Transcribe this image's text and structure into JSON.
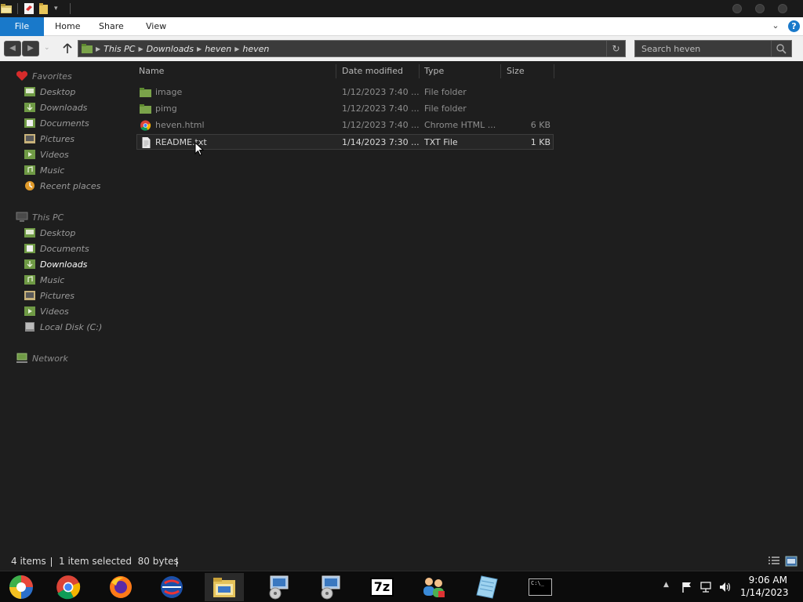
{
  "window": {
    "quick_access": [
      "explorer-icon",
      "properties-icon",
      "new-folder-icon",
      "customize-qa-icon"
    ]
  },
  "ribbon": {
    "tabs": [
      {
        "label": "File"
      },
      {
        "label": "Home"
      },
      {
        "label": "Share"
      },
      {
        "label": "View"
      }
    ],
    "help": "?"
  },
  "navbar": {
    "breadcrumb": [
      "This PC",
      "Downloads",
      "heven",
      "heven"
    ],
    "search_placeholder": "Search heven"
  },
  "sidebar": {
    "favorites": {
      "label": "Favorites",
      "items": [
        {
          "label": "Desktop",
          "icon": "desktop-icon"
        },
        {
          "label": "Downloads",
          "icon": "downloads-folder-icon"
        },
        {
          "label": "Documents",
          "icon": "documents-icon"
        },
        {
          "label": "Pictures",
          "icon": "pictures-icon"
        },
        {
          "label": "Videos",
          "icon": "videos-icon"
        },
        {
          "label": "Music",
          "icon": "music-icon"
        },
        {
          "label": "Recent places",
          "icon": "recent-places-icon"
        }
      ]
    },
    "this_pc": {
      "label": "This PC",
      "items": [
        {
          "label": "Desktop",
          "icon": "desktop-icon"
        },
        {
          "label": "Documents",
          "icon": "documents-icon"
        },
        {
          "label": "Downloads",
          "icon": "downloads-folder-icon",
          "active": true
        },
        {
          "label": "Music",
          "icon": "music-icon"
        },
        {
          "label": "Pictures",
          "icon": "pictures-icon"
        },
        {
          "label": "Videos",
          "icon": "videos-icon"
        },
        {
          "label": "Local Disk (C:)",
          "icon": "local-disk-icon"
        }
      ]
    },
    "network": {
      "label": "Network"
    }
  },
  "files": {
    "columns": [
      "Name",
      "Date modified",
      "Type",
      "Size"
    ],
    "rows": [
      {
        "name": "image",
        "date": "1/12/2023 7:40 ...",
        "type": "File folder",
        "size": "",
        "icon": "folder-icon"
      },
      {
        "name": "pimg",
        "date": "1/12/2023 7:40 ...",
        "type": "File folder",
        "size": "",
        "icon": "folder-icon"
      },
      {
        "name": "heven.html",
        "date": "1/12/2023 7:40 ...",
        "type": "Chrome HTML ...",
        "size": "6 KB",
        "icon": "chrome-html-icon"
      },
      {
        "name": "README.txt",
        "date": "1/14/2023 7:30 ...",
        "type": "TXT File",
        "size": "1 KB",
        "icon": "text-file-icon",
        "selected": true
      }
    ]
  },
  "status": {
    "item_count": "4 items",
    "selection": "1 item selected  80 bytes"
  },
  "taskbar": {
    "apps": [
      {
        "icon": "start-icon"
      },
      {
        "icon": "chrome-icon"
      },
      {
        "icon": "firefox-icon"
      },
      {
        "icon": "opera-icon"
      },
      {
        "icon": "file-explorer-icon",
        "active": true
      },
      {
        "icon": "installer-icon"
      },
      {
        "icon": "installer-icon"
      },
      {
        "icon": "7zip-icon",
        "label": "7z"
      },
      {
        "icon": "network-users-icon"
      },
      {
        "icon": "notepad-icon"
      },
      {
        "icon": "command-prompt-icon",
        "label": "C:\\_"
      }
    ],
    "time": "9:06 AM",
    "date": "1/14/2023"
  },
  "colors": {
    "accent": "#1979ca",
    "background": "#1e1e1e"
  }
}
